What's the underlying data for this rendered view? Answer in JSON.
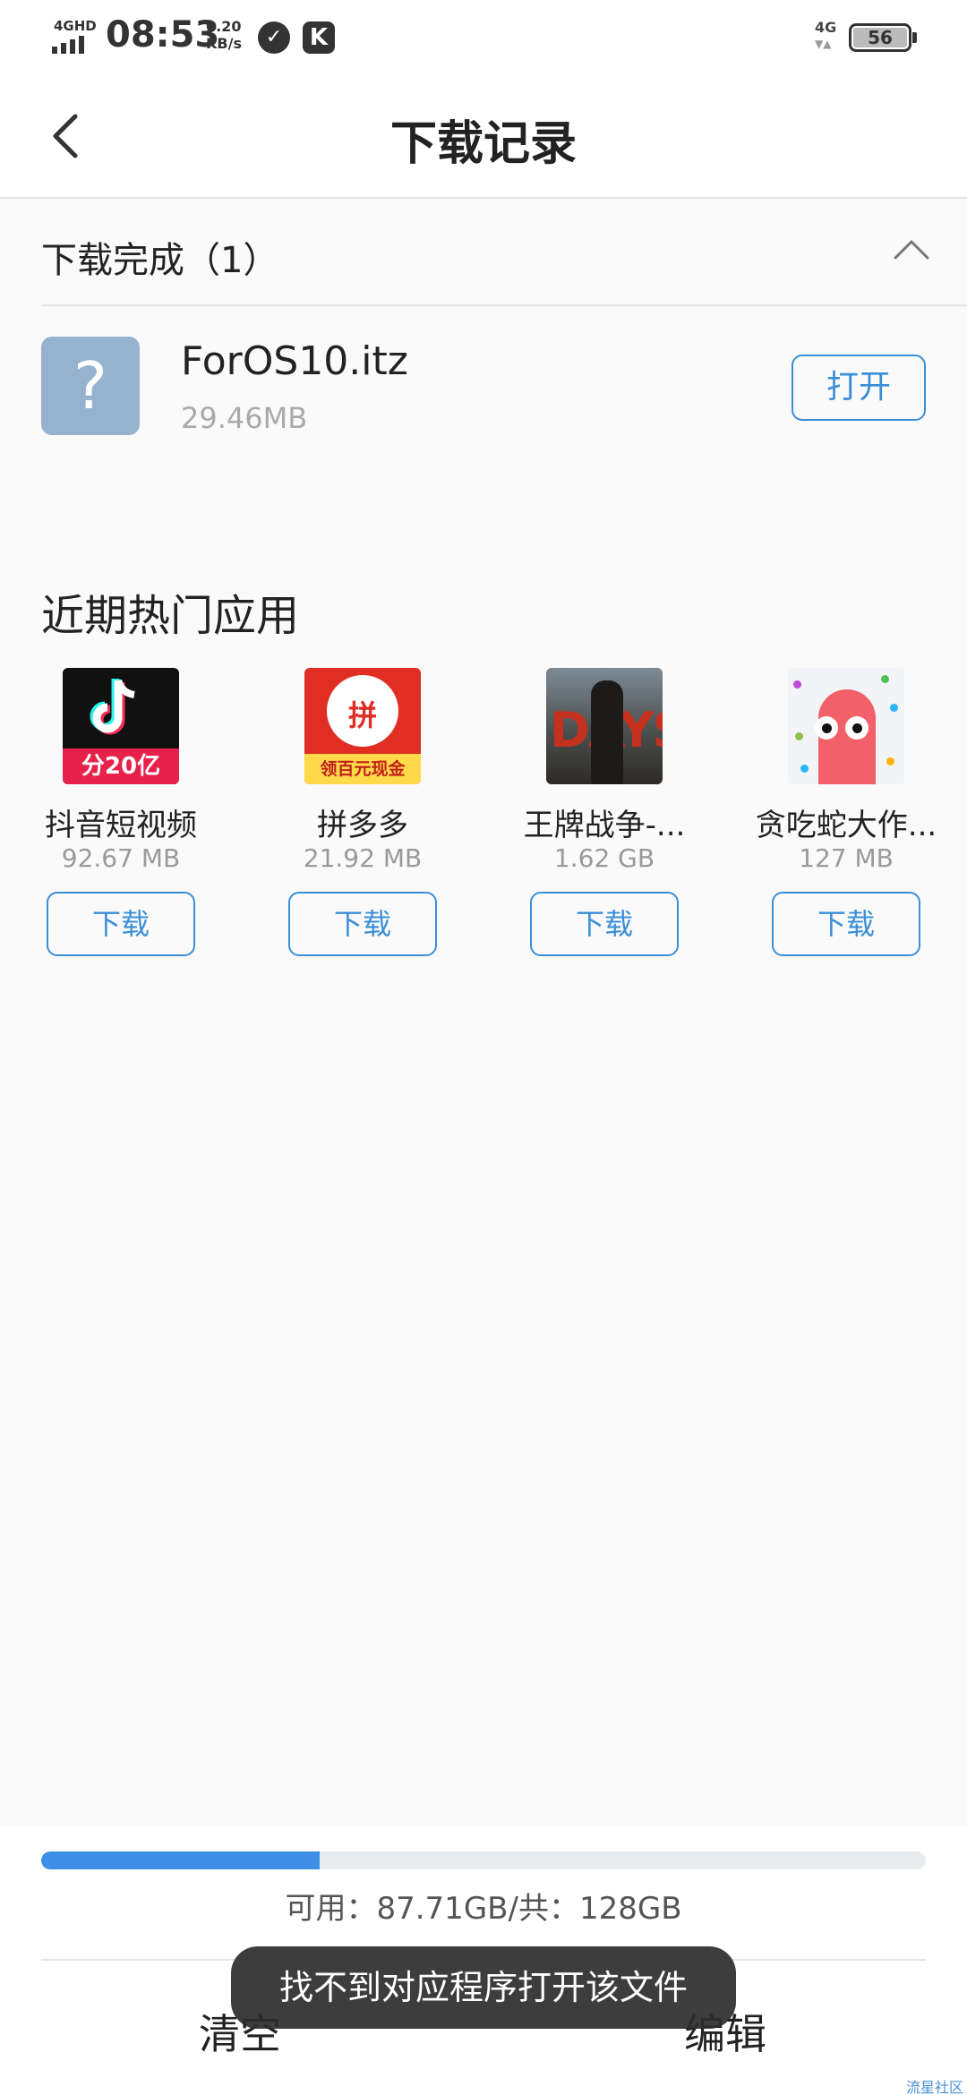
{
  "status_bar": {
    "network_type": "4GHD",
    "time": "08:53",
    "speed_value": "0.20",
    "speed_unit": "KB/s",
    "network_type_right": "4G",
    "battery": "56"
  },
  "header": {
    "title": "下载记录"
  },
  "downloaded": {
    "section_title": "下载完成（1）",
    "file": {
      "name": "ForOS10.itz",
      "size": "29.46MB",
      "icon_symbol": "?",
      "open_label": "打开"
    }
  },
  "hot_apps": {
    "title": "近期热门应用",
    "items": [
      {
        "name": "抖音短视频",
        "size": "92.67 MB",
        "download_label": "下载",
        "icon_text": "分20亿"
      },
      {
        "name": "拼多多",
        "size": "21.92 MB",
        "download_label": "下载",
        "icon_text": "领百元现金",
        "icon_glyph": "拼"
      },
      {
        "name": "王牌战争-...",
        "size": "1.62 GB",
        "download_label": "下载",
        "icon_text": "DAYS"
      },
      {
        "name": "贪吃蛇大作...",
        "size": "127 MB",
        "download_label": "下载"
      }
    ]
  },
  "storage": {
    "text": "可用：87.71GB/共：128GB",
    "used_fraction": 0.315
  },
  "footer": {
    "clear_label": "清空",
    "edit_label": "编辑"
  },
  "toast": {
    "message": "找不到对应程序打开该文件"
  },
  "watermark": "流星社区",
  "colors": {
    "accent": "#3b8ed8",
    "progress": "#3c8ee6",
    "file_icon": "#95b2cf"
  }
}
